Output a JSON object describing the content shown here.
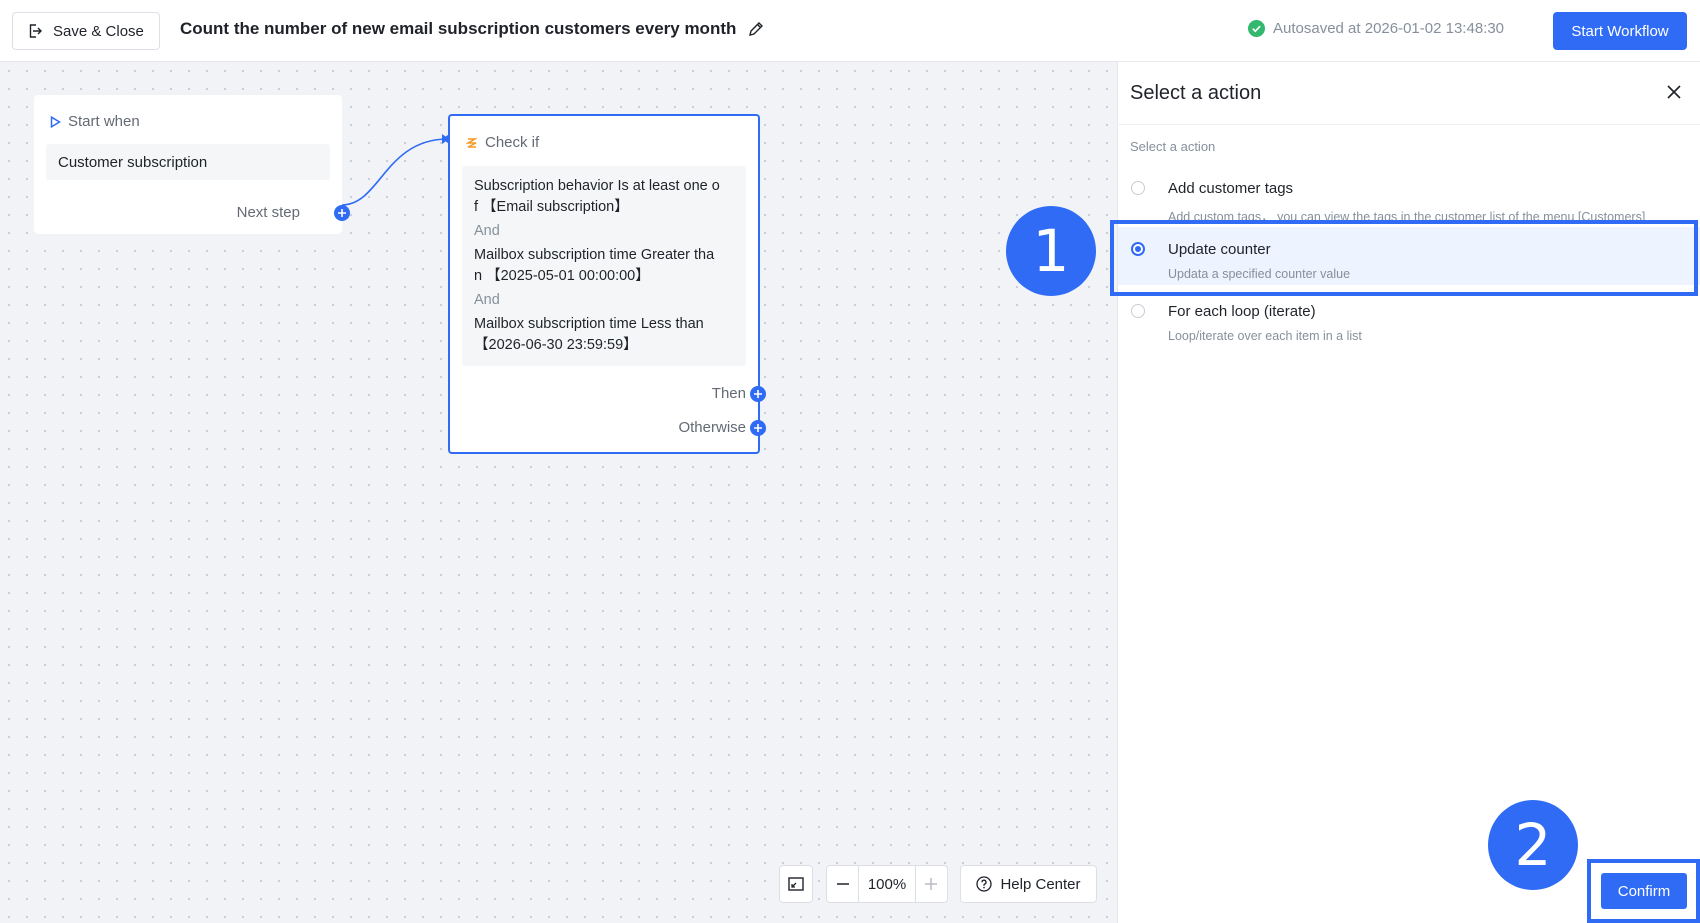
{
  "header": {
    "save_close_label": "Save & Close",
    "title": "Count the number of new email subscription customers every month",
    "autosave_text": "Autosaved at 2026-01-02 13:48:30",
    "start_workflow_label": "Start Workflow"
  },
  "canvas": {
    "start_node": {
      "heading": "Start when",
      "trigger": "Customer subscription",
      "next_step_label": "Next step"
    },
    "check_node": {
      "heading": "Check if",
      "condition_1_a": "Subscription behavior Is at least one o",
      "condition_1_b": "f 【Email subscription】",
      "and_1": "And",
      "condition_2_a": "Mailbox subscription time Greater tha",
      "condition_2_b": "n 【2025-05-01 00:00:00】",
      "and_2": "And",
      "condition_3_a": "Mailbox subscription time Less than",
      "condition_3_b": "【2026-06-30 23:59:59】",
      "then_label": "Then",
      "otherwise_label": "Otherwise"
    },
    "toolbar": {
      "zoom_value": "100%",
      "help_center_label": "Help Center"
    }
  },
  "panel": {
    "title": "Select a action",
    "subtitle": "Select a action",
    "options": [
      {
        "title": "Add customer tags",
        "desc": "Add custom tags， you can view the tags in the customer list of the menu [Customers]",
        "selected": false
      },
      {
        "title": "Update counter",
        "desc": "Updata a specified counter value",
        "selected": true
      },
      {
        "title": "For each loop (iterate)",
        "desc": "Loop/iterate over each item in a list",
        "selected": false
      }
    ],
    "confirm_label": "Confirm"
  },
  "annotations": {
    "badge_1": "1",
    "badge_2": "2"
  },
  "colors": {
    "accent": "#2f6bf5",
    "success": "#34b86e",
    "canvas_bg": "#f1f3f7"
  }
}
